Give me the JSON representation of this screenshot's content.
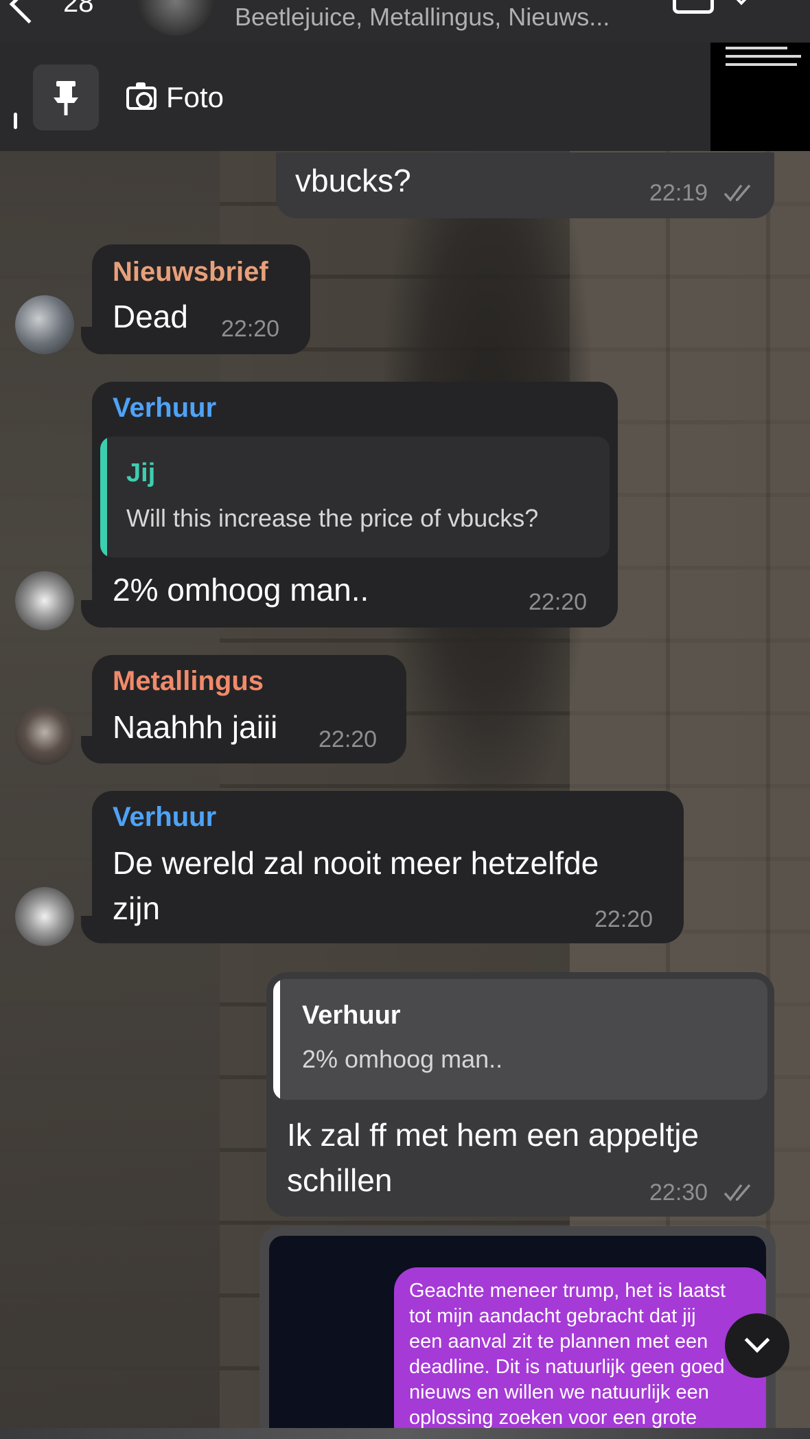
{
  "header": {
    "back_count": "28",
    "subtitle": "Beetlejuice, Metallingus, Nieuws..."
  },
  "pinned": {
    "label": "Foto",
    "thumbnail_lines": [
      "09, for Walt",
      "September 2024: Theater (Sunday)",
      "September 14 · Schrik gemist (Sinterley)"
    ]
  },
  "messages": [
    {
      "id": "m1",
      "direction": "out",
      "text": "vbucks?",
      "time": "22:19",
      "read": true
    },
    {
      "id": "m2",
      "direction": "in",
      "sender": "Nieuwsbrief",
      "sender_color": "#e8a07a",
      "text": "Dead",
      "time": "22:20"
    },
    {
      "id": "m3",
      "direction": "in",
      "sender": "Verhuur",
      "sender_color": "#4fa3f7",
      "quote": {
        "name": "Jij",
        "name_color": "#3ccfb0",
        "text": "Will this increase the price of vbucks?"
      },
      "text": "2% omhoog man..",
      "time": "22:20"
    },
    {
      "id": "m4",
      "direction": "in",
      "sender": "Metallingus",
      "sender_color": "#f28a6a",
      "text": "Naahhh jaiii",
      "time": "22:20"
    },
    {
      "id": "m5",
      "direction": "in",
      "sender": "Verhuur",
      "sender_color": "#4fa3f7",
      "text_line1": "De wereld zal nooit meer hetzelfde",
      "text_line2": "zijn",
      "time": "22:20"
    },
    {
      "id": "m6",
      "direction": "out",
      "quote": {
        "name": "Verhuur",
        "name_color": "#ffffff",
        "text": "2% omhoog man.."
      },
      "text_line1": "Ik zal ff met hem een appeltje",
      "text_line2": "schillen",
      "time": "22:30",
      "read": true
    }
  ],
  "image_message": {
    "text": "Geachte meneer trump, het is laatst\ntot mijn aandacht gebracht dat jij\neen aanval zit te plannen met een\ndeadline. Dit is natuurlijk geen goed\nnieuws en willen we natuurlijk een\noplossing zoeken voor een grote"
  },
  "colors": {
    "incoming_bubble": "#242426",
    "outgoing_bubble": "#3a3a3c",
    "timestamp": "#8e8e93",
    "purple_bubble": "#a53ad6"
  }
}
